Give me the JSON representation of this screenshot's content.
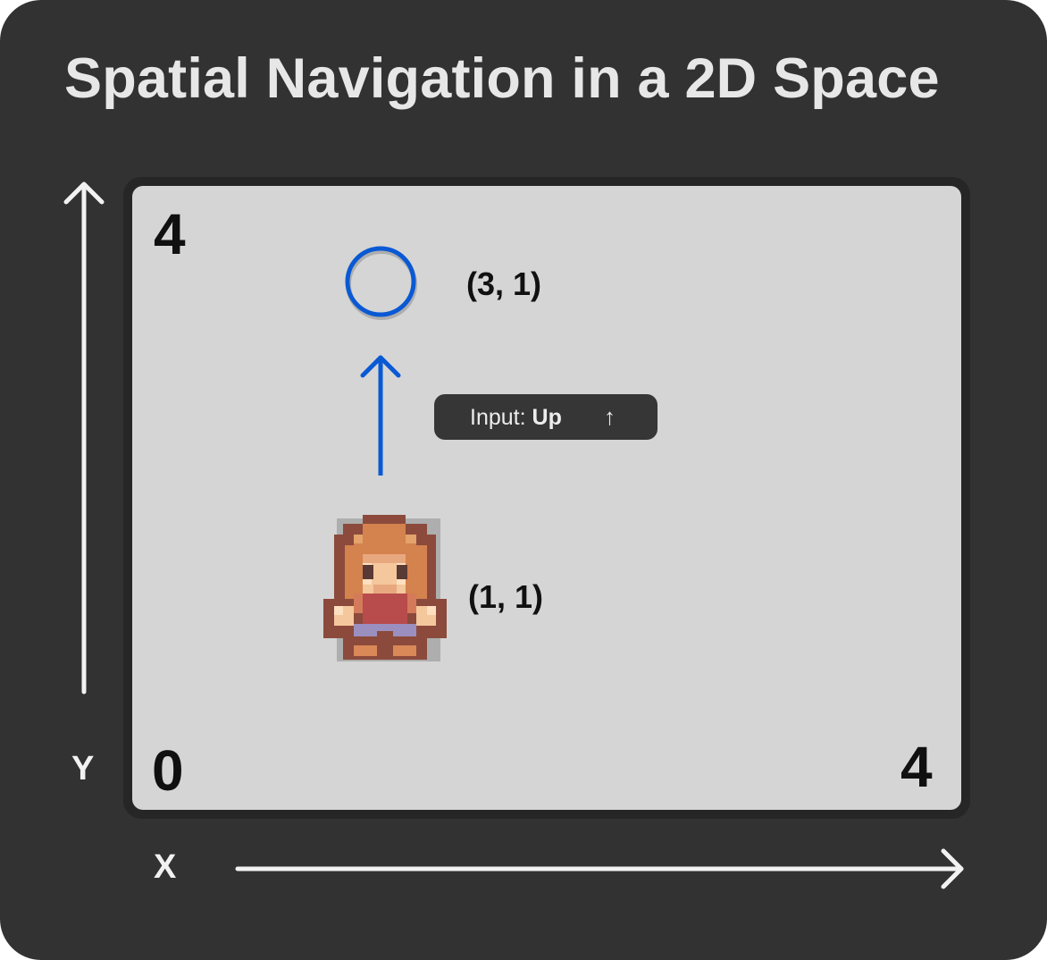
{
  "title": "Spatial Navigation in a 2D Space",
  "axes": {
    "y_label": "Y",
    "x_label": "X",
    "y_top": "4",
    "origin": "0",
    "x_right": "4"
  },
  "target": {
    "coord_label": "(3, 1)",
    "color": "#0a59d4"
  },
  "player": {
    "coord_label": "(1, 1)"
  },
  "input_pill": {
    "prefix": "Input:",
    "value": "Up",
    "arrow": "↑"
  },
  "colors": {
    "background": "#323232",
    "board": "#d5d5d5",
    "accent": "#0a59d4",
    "text_light": "#e7e7e7"
  }
}
